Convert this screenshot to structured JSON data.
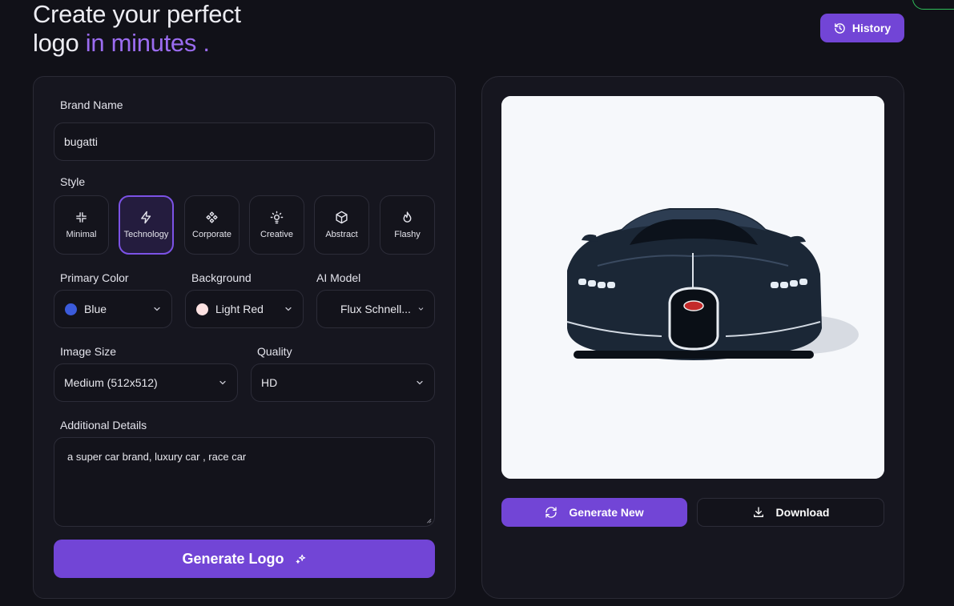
{
  "header": {
    "title_line1": "Create your perfect",
    "title_line2_start": "logo",
    "title_line2_accent": "in minutes .",
    "history_label": "History"
  },
  "form": {
    "brand_name": {
      "label": "Brand Name",
      "value": "bugatti"
    },
    "style": {
      "label": "Style",
      "options": [
        {
          "label": "Minimal",
          "icon": "minimize-icon",
          "selected": false
        },
        {
          "label": "Technology",
          "icon": "lightning-icon",
          "selected": true
        },
        {
          "label": "Corporate",
          "icon": "diamond-grid-icon",
          "selected": false
        },
        {
          "label": "Creative",
          "icon": "lightbulb-icon",
          "selected": false
        },
        {
          "label": "Abstract",
          "icon": "cube-icon",
          "selected": false
        },
        {
          "label": "Flashy",
          "icon": "flame-icon",
          "selected": false
        }
      ]
    },
    "primary_color": {
      "label": "Primary Color",
      "value": "Blue",
      "swatch": "#3b5bdb"
    },
    "background": {
      "label": "Background",
      "value": "Light Red",
      "swatch": "#fde2e2"
    },
    "ai_model": {
      "label": "AI Model",
      "value": "Flux Schnell..."
    },
    "image_size": {
      "label": "Image Size",
      "value": "Medium (512x512)"
    },
    "quality": {
      "label": "Quality",
      "value": "HD"
    },
    "additional_details": {
      "label": "Additional Details",
      "value": "a super car brand, luxury car , race car"
    },
    "generate_label": "Generate Logo"
  },
  "preview": {
    "generate_new_label": "Generate New",
    "download_label": "Download"
  },
  "colors": {
    "accent": "#7245d6",
    "background": "#111118",
    "panel": "#16161f"
  }
}
